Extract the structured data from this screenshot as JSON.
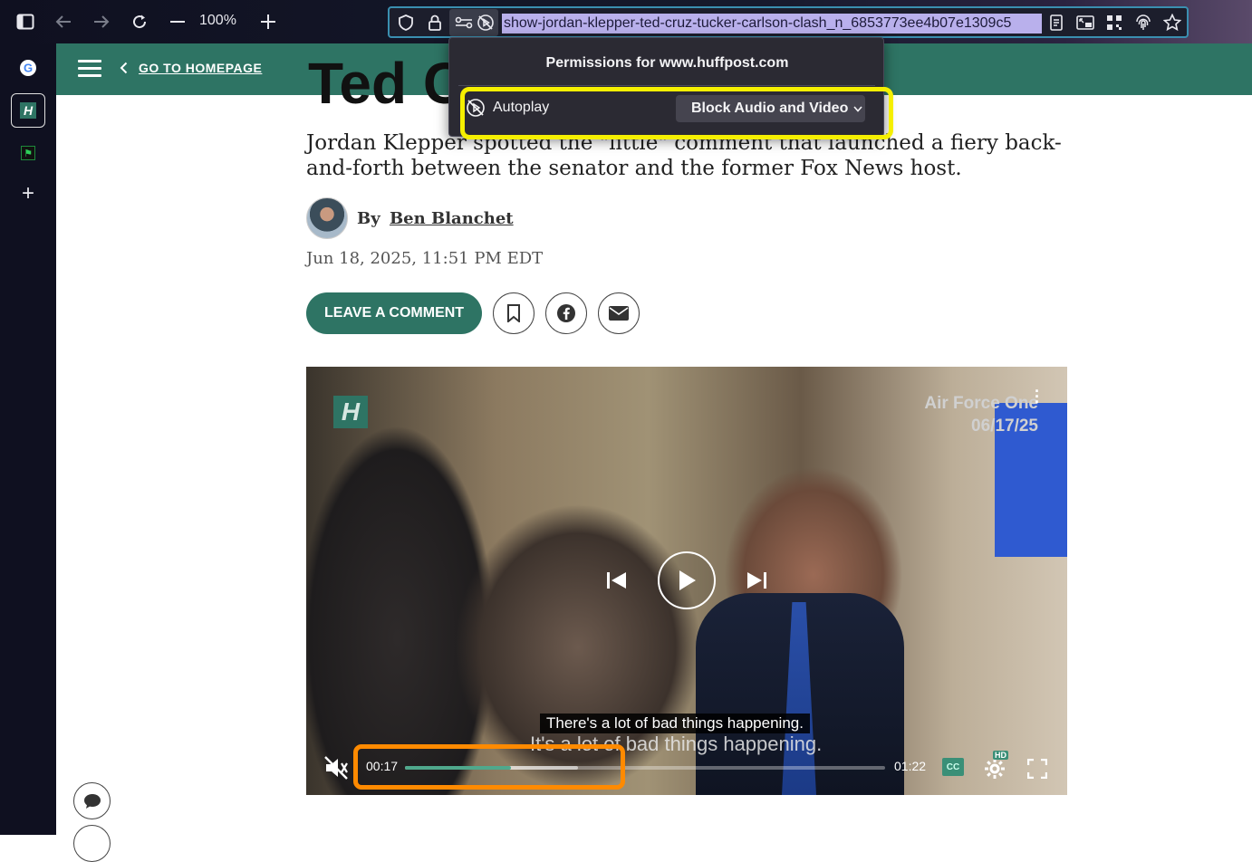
{
  "browser": {
    "zoom": "100%",
    "url": "show-jordan-klepper-ted-cruz-tucker-carlson-clash_n_6853773ee4b07e1309c5",
    "icons": [
      "sidebar-toggle-icon",
      "back-icon",
      "forward-icon",
      "reload-icon",
      "zoom-out-icon",
      "zoom-in-icon",
      "shield-icon",
      "lock-icon",
      "permissions-icon",
      "autoplay-blocked-icon",
      "reader-view-icon",
      "picture-in-picture-icon",
      "qr-icon",
      "fingerprint-icon",
      "bookmark-star-icon"
    ]
  },
  "sidebar": {
    "items": [
      {
        "name": "google",
        "glyph": "G"
      },
      {
        "name": "huffpost",
        "glyph": "H"
      },
      {
        "name": "flag-app",
        "glyph": "⚑"
      },
      {
        "name": "add",
        "glyph": "+"
      }
    ]
  },
  "permissions_popup": {
    "title": "Permissions for www.huffpost.com",
    "row_label": "Autoplay",
    "selected": "Block Audio and Video"
  },
  "header": {
    "home_link": "GO TO HOMEPAGE"
  },
  "article": {
    "headline_fragment": "Ted C",
    "subheadline": "Jordan Klepper spotted the \"little\" comment that launched a fiery back-and-forth between the senator and the former Fox News host.",
    "byline_prefix": "By",
    "author": "Ben Blanchet",
    "date": "Jun 18, 2025, 11:51 PM EDT",
    "comment_button": "LEAVE A COMMENT"
  },
  "video": {
    "logo": "H",
    "location_line1": "Air Force One",
    "location_line2": "06/17/25",
    "caption": "There's a lot of bad things happening.",
    "burned_caption": "It's a lot of bad things happening.",
    "current_time": "00:17",
    "total_time": "01:22",
    "progress_fraction": 0.22,
    "buffered_fraction": 0.36,
    "cc_label": "CC",
    "hd_label": "HD",
    "muted": true
  },
  "colors": {
    "brand": "#2e7464",
    "highlight_yellow": "#f5ef00",
    "highlight_orange": "#ff8a00"
  }
}
